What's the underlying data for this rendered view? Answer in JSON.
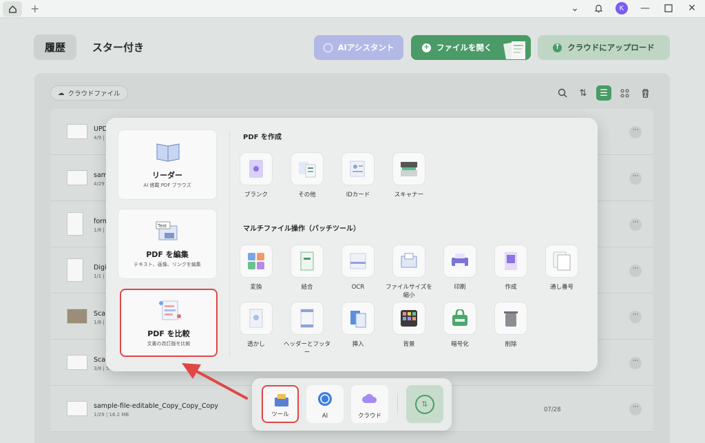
{
  "tabs": {
    "history": "履歴",
    "starred": "スター付き"
  },
  "buttons": {
    "ai": "AIアシスタント",
    "open": "ファイルを開く",
    "upload": "クラウドにアップロード"
  },
  "cloud_chip": "クラウドファイル",
  "files": [
    {
      "name": "UPD",
      "meta": "4/9 |"
    },
    {
      "name": "sam",
      "meta": "4/29"
    },
    {
      "name": "form",
      "meta": "1/6 |"
    },
    {
      "name": "Digi",
      "meta": "1/1 |"
    },
    {
      "name": "Scan",
      "meta": "1/8 |"
    },
    {
      "name": "Scan",
      "meta": "3/8 | 53"
    },
    {
      "name": "sample-file-editable_Copy_Copy_Copy",
      "meta": "1/29 | 16.2 MB",
      "date": "07/28"
    }
  ],
  "more_label": "···",
  "side": {
    "reader": {
      "title": "リーダー",
      "sub": "AI 搭載 PDF ブラウズ"
    },
    "edit": {
      "title": "PDF を編集",
      "sub": "テキスト、画像、リンクを編集",
      "art_text": "Text"
    },
    "compare": {
      "title": "PDF を比較",
      "sub": "文書の改訂版を比較"
    }
  },
  "create": {
    "title": "PDF を作成",
    "items": [
      "ブランク",
      "その他",
      "IDカード",
      "スキャナー"
    ]
  },
  "batch": {
    "title": "マルチファイル操作（バッチツール）",
    "row1": [
      "変換",
      "結合",
      "OCR",
      "ファイルサイズを縮小",
      "印刷",
      "作成",
      "通し番号"
    ],
    "row2": [
      "透かし",
      "ヘッダーとフッター",
      "挿入",
      "背景",
      "暗号化",
      "削除"
    ]
  },
  "dock": {
    "tools": "ツール",
    "ai": "AI",
    "cloud": "クラウド"
  },
  "avatar": "K",
  "accent": "#4a9b67",
  "highlight_color": "#e04646"
}
